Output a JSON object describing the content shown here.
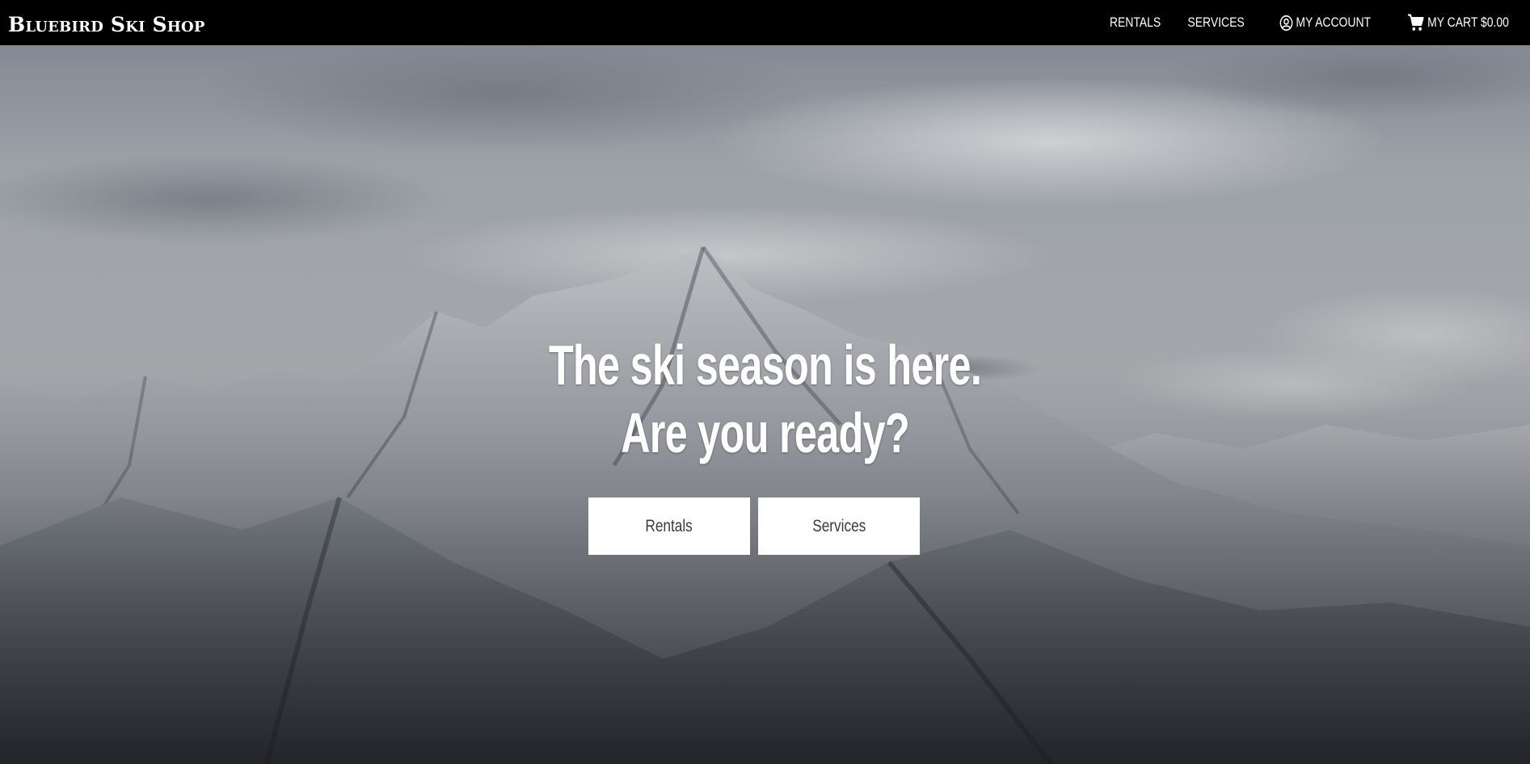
{
  "nav": {
    "brand": "Bluebird Ski Shop",
    "links": [
      {
        "label": "RENTALS"
      },
      {
        "label": "SERVICES"
      },
      {
        "label": "MY ACCOUNT",
        "icon": "account-circle-icon"
      },
      {
        "label": "MY CART $0.00",
        "icon": "shopping-cart-icon"
      }
    ]
  },
  "hero": {
    "headline_line1": "The ski season is here.",
    "headline_line2": "Are you ready?",
    "background": "snowy-mountain-peak-photo",
    "buttons": [
      {
        "label": "Rentals"
      },
      {
        "label": "Services"
      }
    ]
  },
  "colors": {
    "navbar": "#000000",
    "button_bg": "#ffffff",
    "button_text": "#3a3a3a",
    "headline": "#ffffff"
  }
}
